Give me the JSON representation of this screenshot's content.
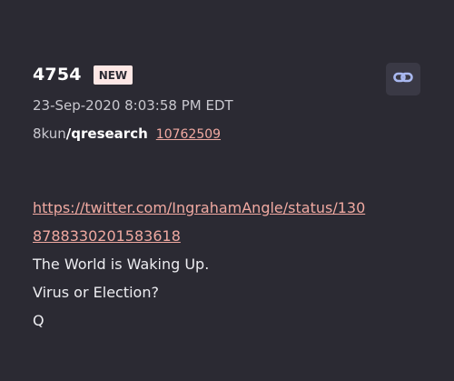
{
  "post": {
    "number": "4754",
    "badge": "NEW",
    "timestamp": "23-Sep-2020 8:03:58 PM EDT",
    "site": "8kun",
    "board": "/qresearch",
    "post_ref": "10762509",
    "link_url_line1": "https://twitter.com/IngrahamAngle/status/130",
    "link_url_line2": "8788330201583618",
    "lines": [
      "The World is Waking Up.",
      "Virus or Election?",
      "Q"
    ]
  },
  "icons": {
    "copy_link": "link-icon"
  },
  "colors": {
    "background": "#2b2a33",
    "accent_link": "#f0a9a1",
    "badge_bg": "#fde7e5",
    "icon_color": "#a9b8f0"
  }
}
